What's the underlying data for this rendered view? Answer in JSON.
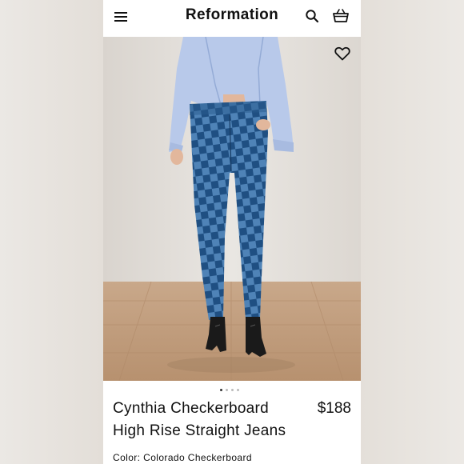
{
  "header": {
    "brand": "Reformation"
  },
  "icons": {
    "menu": "hamburger-menu-icon",
    "search": "search-icon",
    "bag": "shopping-bag-icon",
    "wishlist": "heart-icon"
  },
  "product": {
    "name": "Cynthia Checkerboard High Rise Straight Jeans",
    "price": "$188",
    "color_label": "Color: Colorado Checkerboard"
  },
  "gallery": {
    "image_count": 4,
    "active_index": 0
  }
}
